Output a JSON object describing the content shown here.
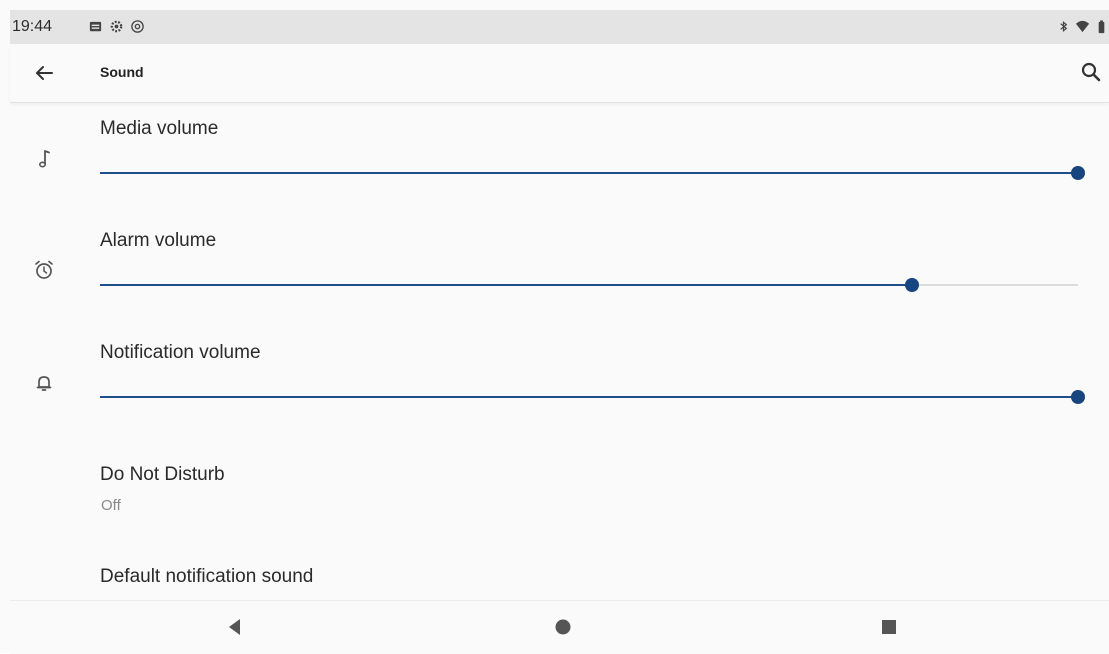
{
  "status_bar": {
    "time": "19:44",
    "left_icons": [
      "image-icon",
      "gear-icon",
      "at-sign-icon"
    ],
    "right_icons": [
      "bluetooth-icon",
      "wifi-icon",
      "battery-icon"
    ]
  },
  "app_bar": {
    "title": "Sound",
    "back_icon": "arrow-left-icon",
    "search_icon": "search-icon"
  },
  "settings": {
    "media": {
      "label": "Media volume",
      "icon": "music-note-icon",
      "level": 1.0
    },
    "alarm": {
      "label": "Alarm volume",
      "icon": "alarm-clock-icon",
      "level": 0.83
    },
    "notification": {
      "label": "Notification volume",
      "icon": "bell-icon",
      "level": 1.0
    },
    "dnd": {
      "label": "Do Not Disturb",
      "value": "Off"
    },
    "default_notification": {
      "label": "Default notification sound"
    }
  },
  "nav_bar": {
    "icons": [
      "back-triangle-icon",
      "home-circle-icon",
      "recents-square-icon"
    ]
  },
  "colors": {
    "accent": "#17457f",
    "track": "#dcdcdc",
    "status_bar_bg": "#e4e4e4",
    "background": "#fafafa"
  }
}
